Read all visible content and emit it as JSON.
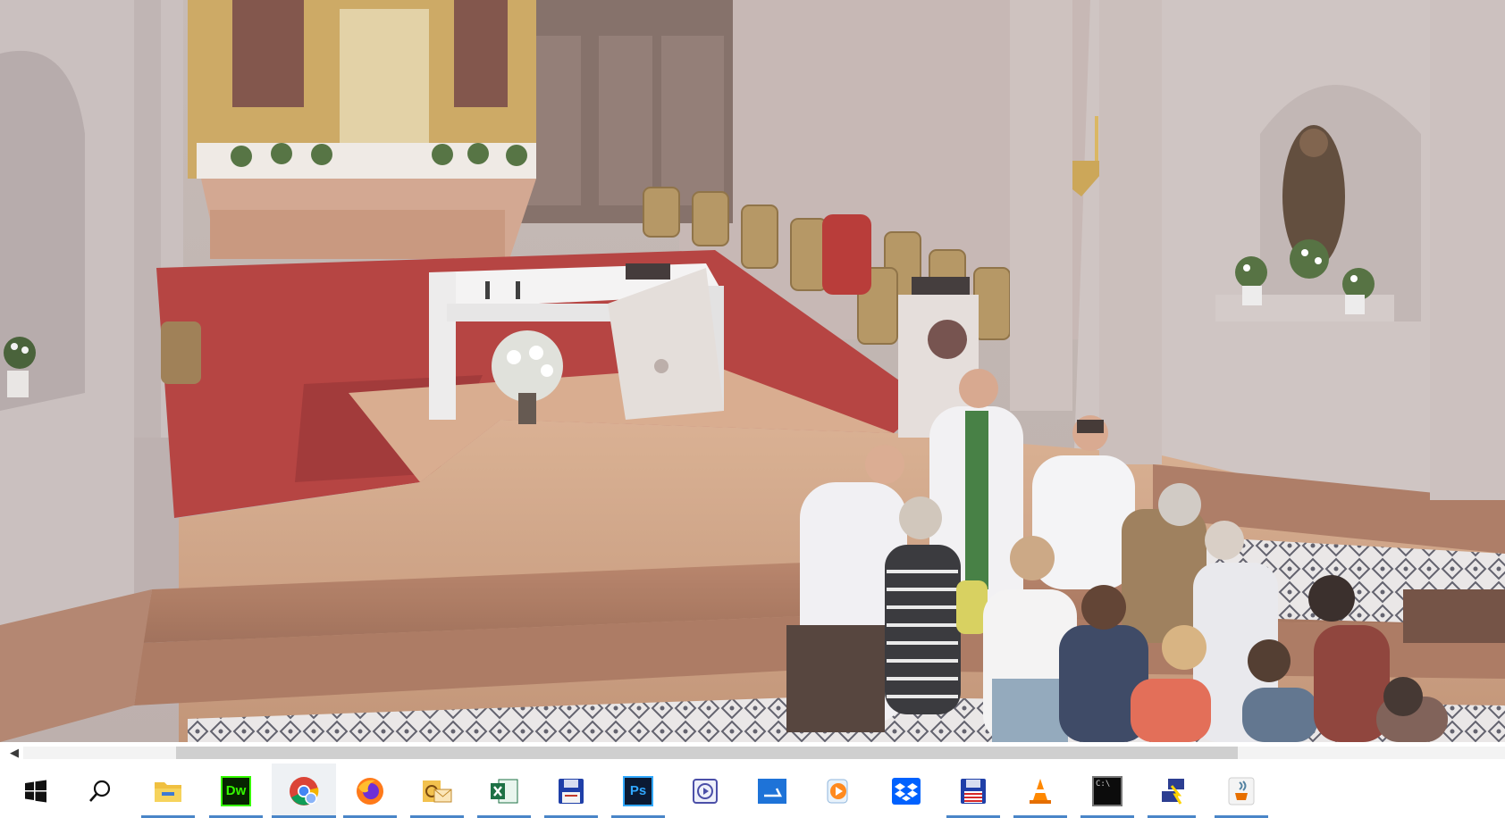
{
  "viewer": {
    "horizontal_scrollbar": {
      "left_arrow": "◀"
    }
  },
  "taskbar": {
    "start_icon": "windows-logo-icon",
    "search_icon": "search-icon",
    "apps": [
      {
        "name": "file-explorer",
        "icon": "folder-icon",
        "running": true
      },
      {
        "name": "dreamweaver",
        "icon": "dreamweaver-icon",
        "label": "Dw",
        "running": true
      },
      {
        "name": "chrome",
        "icon": "chrome-icon",
        "running": true,
        "active": true
      },
      {
        "name": "firefox",
        "icon": "firefox-icon",
        "running": true
      },
      {
        "name": "outlook",
        "icon": "outlook-mail-icon",
        "running": true
      },
      {
        "name": "excel",
        "icon": "excel-icon",
        "running": true
      },
      {
        "name": "save-utility",
        "icon": "floppy-disk-icon",
        "running": true
      },
      {
        "name": "photoshop",
        "icon": "photoshop-icon",
        "label": "Ps",
        "running": true
      },
      {
        "name": "video-app",
        "icon": "video-app-icon",
        "running": false
      },
      {
        "name": "scanner",
        "icon": "scanner-icon",
        "running": false
      },
      {
        "name": "media-player",
        "icon": "media-player-icon",
        "running": false
      },
      {
        "name": "dropbox",
        "icon": "dropbox-icon",
        "running": false
      },
      {
        "name": "save-utility-2",
        "icon": "floppy-disk-flag-icon",
        "running": true
      },
      {
        "name": "vlc",
        "icon": "vlc-cone-icon",
        "running": true
      },
      {
        "name": "command-prompt",
        "icon": "terminal-icon",
        "label": "C:\\",
        "running": true
      },
      {
        "name": "network-tool",
        "icon": "network-icon",
        "running": true,
        "partial": true
      },
      {
        "name": "java",
        "icon": "java-icon",
        "running": true
      }
    ]
  },
  "colors": {
    "taskbar_bg": "#ffffff",
    "running_indicator": "#4a86c8",
    "carpet": "#b33a3a",
    "marble": "#c89a7c",
    "wall": "#c9bdb9"
  }
}
